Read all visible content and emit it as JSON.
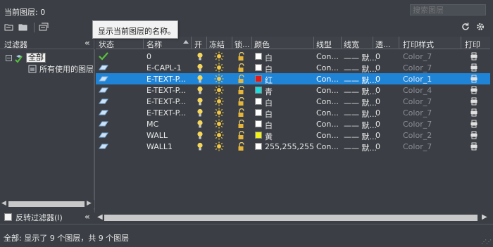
{
  "header": {
    "current_layer_label": "当前图层: 0",
    "search_placeholder": "搜索图层"
  },
  "tooltip": "显示当前图层的名称。",
  "filters": {
    "title": "过滤器",
    "root_label": "全部",
    "child_label": "所有使用的图层",
    "invert_label": "反转过滤器(I)"
  },
  "columns": [
    "状态",
    "名称",
    "开",
    "冻结",
    "锁...",
    "颜色",
    "线型",
    "线宽",
    "透...",
    "打印样式",
    "打印"
  ],
  "layers": [
    {
      "name": "0",
      "color_name": "白",
      "color": "#ffffff",
      "linetype": "Con...",
      "lineweight": "—— 默...",
      "transparency": "0",
      "plot_style": "Color_7",
      "current": true
    },
    {
      "name": "E-CAPL-1",
      "color_name": "白",
      "color": "#ffffff",
      "linetype": "Con...",
      "lineweight": "—— 默...",
      "transparency": "0",
      "plot_style": "Color_7"
    },
    {
      "name": "E-TEXT-P...",
      "color_name": "红",
      "color": "#e21a1a",
      "linetype": "Con...",
      "lineweight": "—— 默...",
      "transparency": "0",
      "plot_style": "Color_1",
      "selected": true
    },
    {
      "name": "E-TEXT-P...",
      "color_name": "青",
      "color": "#1adcdc",
      "linetype": "Con...",
      "lineweight": "—— 默...",
      "transparency": "0",
      "plot_style": "Color_4"
    },
    {
      "name": "E-TEXT-P...",
      "color_name": "白",
      "color": "#ffffff",
      "linetype": "Con...",
      "lineweight": "—— 默...",
      "transparency": "0",
      "plot_style": "Color_7"
    },
    {
      "name": "E-TEXT-P...",
      "color_name": "白",
      "color": "#ffffff",
      "linetype": "Con...",
      "lineweight": "—— 默...",
      "transparency": "0",
      "plot_style": "Color_7"
    },
    {
      "name": "MC",
      "color_name": "白",
      "color": "#ffffff",
      "linetype": "Con...",
      "lineweight": "—— 默...",
      "transparency": "0",
      "plot_style": "Color_7"
    },
    {
      "name": "WALL",
      "color_name": "黄",
      "color": "#f2f21a",
      "linetype": "Con...",
      "lineweight": "—— 默...",
      "transparency": "0",
      "plot_style": "Color_2"
    },
    {
      "name": "WALL1",
      "color_name": "255,255,255",
      "color": "#ffffff",
      "linetype": "Con...",
      "lineweight": "—— 默...",
      "transparency": "0",
      "plot_style": "Color_7"
    }
  ],
  "status_text": "全部: 显示了 9 个图层，共 9 个图层",
  "colors": {
    "background": "#3b3f45",
    "selection": "#1f83d6"
  }
}
